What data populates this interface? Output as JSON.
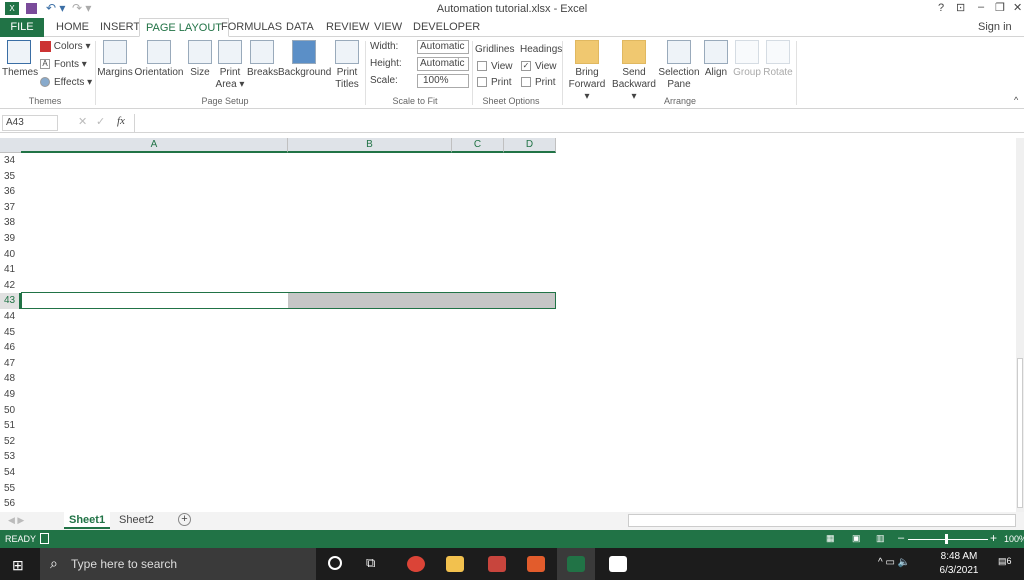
{
  "window": {
    "title": "Automation tutorial.xlsx - Excel",
    "help": "?",
    "sign_in": "Sign in"
  },
  "tabs": [
    {
      "label": "FILE"
    },
    {
      "label": "HOME"
    },
    {
      "label": "INSERT"
    },
    {
      "label": "PAGE LAYOUT",
      "active": true
    },
    {
      "label": "FORMULAS"
    },
    {
      "label": "DATA"
    },
    {
      "label": "REVIEW"
    },
    {
      "label": "VIEW"
    },
    {
      "label": "DEVELOPER"
    }
  ],
  "ribbon": {
    "themes": {
      "themes": "Themes",
      "colors": "Colors ▾",
      "fonts": "Fonts ▾",
      "effects": "Effects ▾",
      "group": "Themes"
    },
    "page_setup": {
      "margins": "Margins",
      "orientation": "Orientation",
      "size": "Size",
      "print_area": "Print Area ▾",
      "breaks": "Breaks",
      "background": "Background",
      "print_titles": "Print Titles",
      "group": "Page Setup"
    },
    "scale": {
      "width_label": "Width:",
      "width_value": "Automatic",
      "height_label": "Height:",
      "height_value": "Automatic",
      "scale_label": "Scale:",
      "scale_value": "100%",
      "group": "Scale to Fit"
    },
    "sheet_options": {
      "gridlines": "Gridlines",
      "headings": "Headings",
      "view": "View",
      "print": "Print",
      "gridlines_view": false,
      "gridlines_print": false,
      "headings_view": true,
      "headings_print": false,
      "group": "Sheet Options"
    },
    "arrange": {
      "bring_forward": "Bring Forward ▾",
      "send_backward": "Send Backward ▾",
      "selection_pane": "Selection Pane",
      "align": "Align",
      "group_btn": "Group",
      "rotate": "Rotate",
      "group": "Arrange"
    }
  },
  "formula_bar": {
    "name_box": "A43",
    "fx": "fx",
    "value": ""
  },
  "grid": {
    "columns": [
      "A",
      "B",
      "C",
      "D"
    ],
    "rows": [
      "34",
      "35",
      "36",
      "37",
      "38",
      "39",
      "40",
      "41",
      "42",
      "43",
      "44",
      "45",
      "46",
      "47",
      "48",
      "49",
      "50",
      "51",
      "52",
      "53",
      "54",
      "55",
      "56"
    ],
    "active_row": "43",
    "selected_range": "A43:D43"
  },
  "sheets": [
    {
      "name": "Sheet1",
      "active": true
    },
    {
      "name": "Sheet2"
    }
  ],
  "status": {
    "mode": "READY",
    "zoom": "100%"
  },
  "taskbar": {
    "search_placeholder": "Type here to search",
    "time": "8:48 AM",
    "date": "6/3/2021",
    "notifications": "6"
  },
  "colors": {
    "accent": "#217346"
  }
}
